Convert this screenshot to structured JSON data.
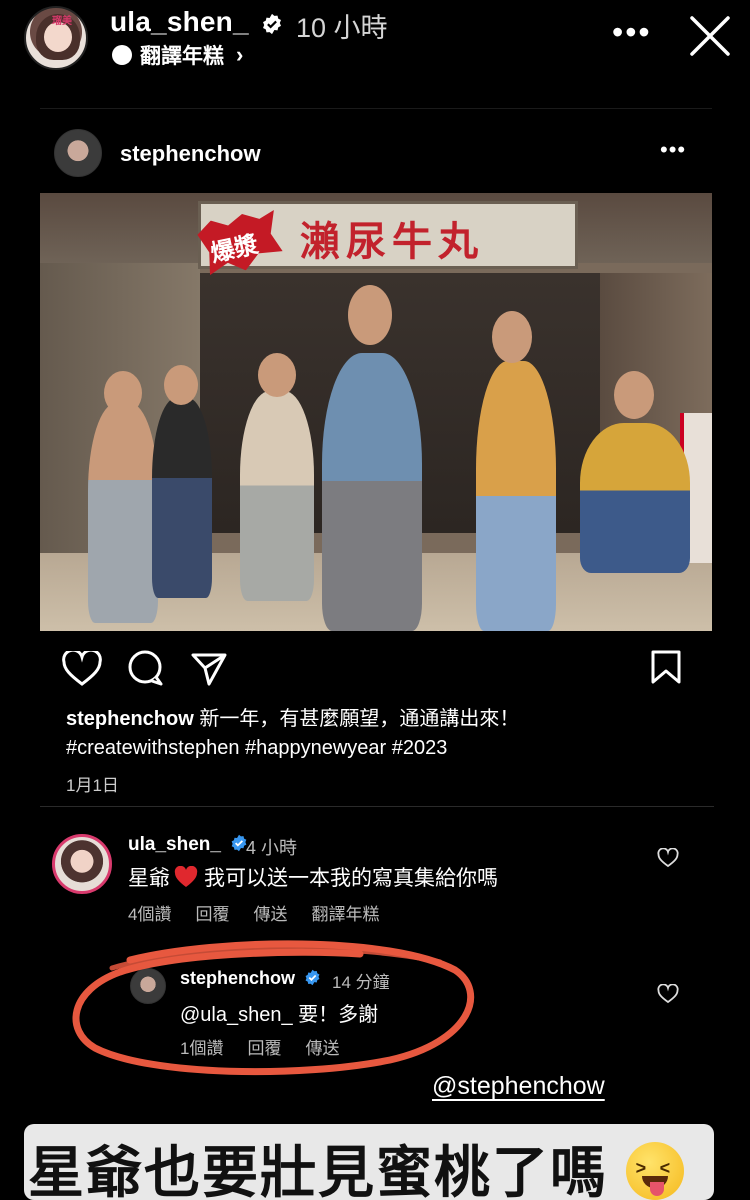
{
  "story": {
    "username": "ula_shen_",
    "time": "10 小時",
    "subtitle": "翻譯年糕",
    "avatar_tag": "瑠美"
  },
  "post": {
    "username": "stephenchow",
    "caption_user": "stephenchow",
    "caption_text": " 新一年，有甚麼願望，通通講出來！",
    "hashtags": "#createwithstephen #happynewyear #2023",
    "date": "1月1日",
    "photo": {
      "sign_text": "瀨尿牛丸",
      "burst_text": "爆漿"
    }
  },
  "comments": [
    {
      "username": "ula_shen_",
      "time": "4 小時",
      "text_before": "星爺",
      "text_after": "我可以送一本我的寫真集給你嗎",
      "likes": "4個讚",
      "reply": "回覆",
      "send": "傳送",
      "translate": "翻譯年糕"
    },
    {
      "username": "stephenchow",
      "time": "14 分鐘",
      "text": "@ula_shen_ 要！多謝",
      "likes": "1個讚",
      "reply": "回覆",
      "send": "傳送"
    }
  ],
  "mention": "@stephenchow",
  "banner": {
    "text": "星爺也要壯見蜜桃了嗎"
  },
  "colors": {
    "verified": "#3897f0",
    "heart": "#e0282e",
    "scribble": "#e7583f",
    "avatar_ring": "#d83a6d"
  }
}
